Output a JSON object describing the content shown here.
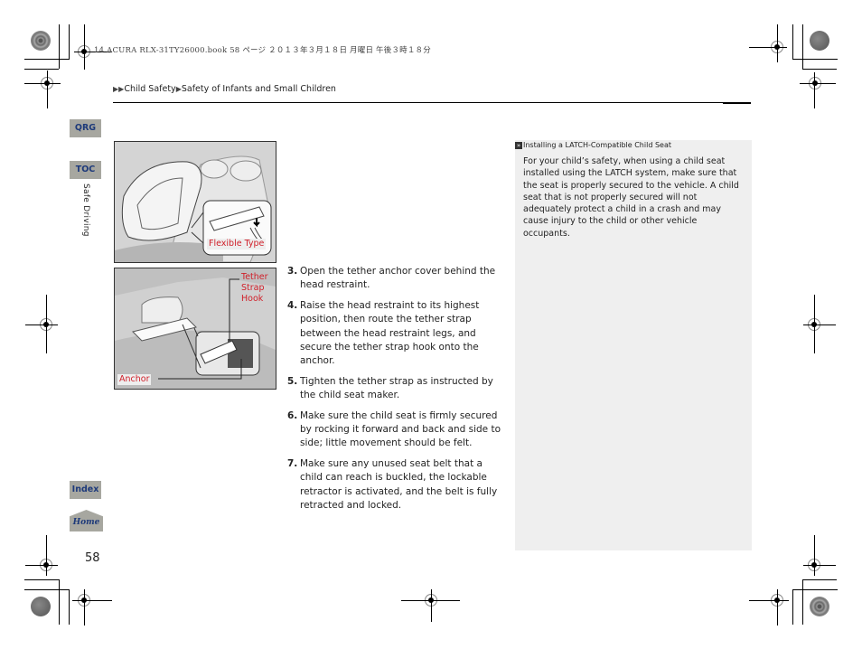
{
  "print_header": "14 ACURA RLX-31TY26000.book  58 ページ  ２０１３年３月１８日  月曜日  午後３時１８分",
  "breadcrumb": {
    "items": [
      "Child Safety",
      "Safety of Infants and Small Children"
    ]
  },
  "nav": {
    "qrg": "QRG",
    "toc": "TOC",
    "index": "Index",
    "home": "Home",
    "section": "Safe Driving"
  },
  "page_number": "58",
  "figures": {
    "fig1": {
      "label": "Flexible Type"
    },
    "fig2": {
      "tether_label": "Tether\nStrap\nHook",
      "tether_lines": [
        "Tether",
        "Strap",
        "Hook"
      ],
      "anchor_label": "Anchor"
    }
  },
  "steps": [
    {
      "num": "3.",
      "text": "Open the tether anchor cover behind the head restraint."
    },
    {
      "num": "4.",
      "text": "Raise the head restraint to its highest position, then route the tether strap between the head restraint legs, and secure the tether strap hook onto the anchor."
    },
    {
      "num": "5.",
      "text": "Tighten the tether strap as instructed by the child seat maker."
    },
    {
      "num": "6.",
      "text": "Make sure the child seat is firmly secured by rocking it forward and back and side to side; little movement should be felt."
    },
    {
      "num": "7.",
      "text": "Make sure any unused seat belt that a child can reach is buckled, the lockable retractor is activated, and the belt is fully retracted and locked."
    }
  ],
  "note": {
    "icon": "»",
    "title": "Installing a LATCH-Compatible Child Seat",
    "body": "For your child’s safety, when using a child seat installed using the LATCH system, make sure that the seat is properly secured to the vehicle. A child seat that is not properly secured will not adequately protect a child in a crash and may cause injury to the child or other vehicle occupants."
  },
  "colors": {
    "nav_button_bg": "#a7a7a0",
    "nav_button_text": "#1e3a7a",
    "figure_label": "#d0202a",
    "note_bg": "#efefef"
  }
}
